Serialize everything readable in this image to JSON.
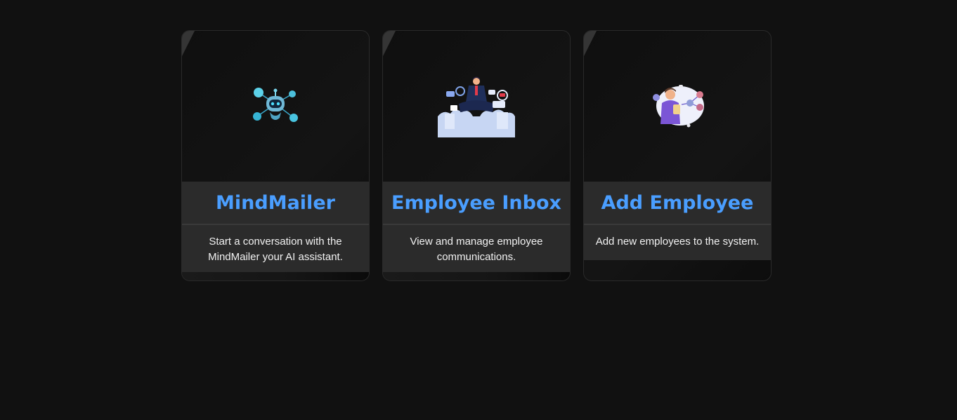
{
  "cards": [
    {
      "title": "MindMailer",
      "description": "Start a conversation with the MindMailer your AI assistant.",
      "icon": "robot-icon"
    },
    {
      "title": "Employee Inbox",
      "description": "View and manage employee communications.",
      "icon": "inbox-illustration-icon"
    },
    {
      "title": "Add Employee",
      "description": "Add new employees to the system.",
      "icon": "add-employee-illustration-icon"
    }
  ],
  "colors": {
    "background": "#111111",
    "card_bar": "#2b2b2b",
    "title_accent": "#4a9eff",
    "text": "#f2f2f2"
  }
}
